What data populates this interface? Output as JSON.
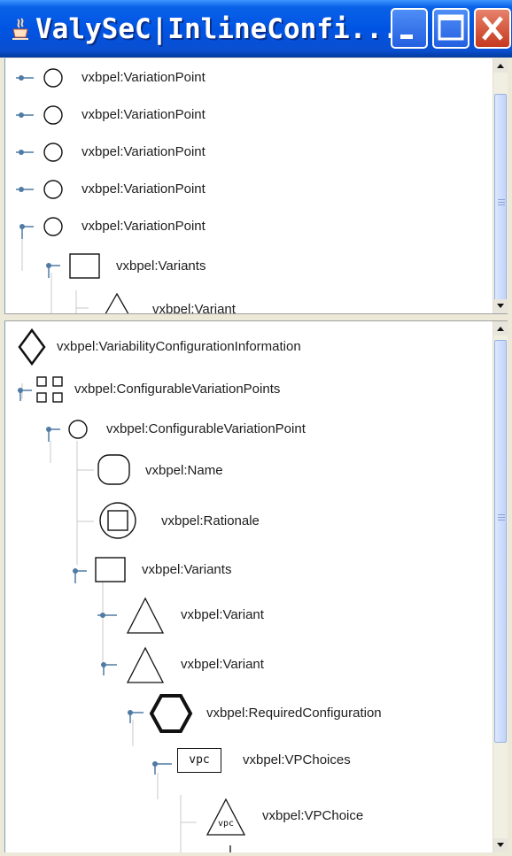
{
  "window": {
    "title": "ValySeC|InlineConfi..."
  },
  "top_tree": {
    "nodes": [
      {
        "label": "vxbpel:VariationPoint",
        "icon": "circle-icon",
        "expanded": false
      },
      {
        "label": "vxbpel:VariationPoint",
        "icon": "circle-icon",
        "expanded": false
      },
      {
        "label": "vxbpel:VariationPoint",
        "icon": "circle-icon",
        "expanded": false
      },
      {
        "label": "vxbpel:VariationPoint",
        "icon": "circle-icon",
        "expanded": false
      },
      {
        "label": "vxbpel:VariationPoint",
        "icon": "circle-icon",
        "expanded": true
      },
      {
        "label": "vxbpel:Variants",
        "icon": "square-icon",
        "expanded": true
      },
      {
        "label": "vxbpel:Variant",
        "icon": "triangle-icon",
        "expanded": null
      }
    ]
  },
  "bottom_tree": {
    "nodes": [
      {
        "label": "vxbpel:VariabilityConfigurationInformation",
        "icon": "diamond-icon"
      },
      {
        "label": "vxbpel:ConfigurableVariationPoints",
        "icon": "four-squares-icon",
        "expanded": true
      },
      {
        "label": "vxbpel:ConfigurableVariationPoint",
        "icon": "circle-icon",
        "expanded": true
      },
      {
        "label": "vxbpel:Name",
        "icon": "rounded-rect-icon"
      },
      {
        "label": "vxbpel:Rationale",
        "icon": "circled-square-icon"
      },
      {
        "label": "vxbpel:Variants",
        "icon": "square-icon",
        "expanded": true
      },
      {
        "label": "vxbpel:Variant",
        "icon": "triangle-icon",
        "expanded": false
      },
      {
        "label": "vxbpel:Variant",
        "icon": "triangle-icon",
        "expanded": true
      },
      {
        "label": "vxbpel:RequiredConfiguration",
        "icon": "hexagon-icon",
        "expanded": true
      },
      {
        "label": "vxbpel:VPChoices",
        "icon": "vpc-box-icon",
        "icon_text": "vpc",
        "expanded": true
      },
      {
        "label": "vxbpel:VPChoice",
        "icon": "vpc-triangle-icon",
        "icon_text": "vpc"
      }
    ]
  },
  "colors": {
    "titlebar": "#0054e3",
    "close_button": "#c5391e",
    "scroll_thumb": "#c2d4fb",
    "tree_line": "#c8c8c8",
    "handle": "#4f7ba4"
  }
}
